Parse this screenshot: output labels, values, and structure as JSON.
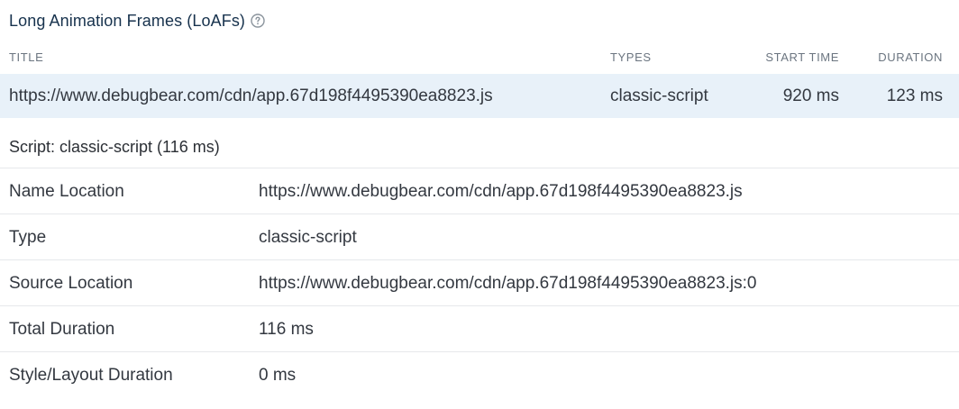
{
  "section": {
    "title": "Long Animation Frames (LoAFs)",
    "help_icon": "help-circle-icon"
  },
  "table": {
    "headers": {
      "title": "TITLE",
      "types": "TYPES",
      "start_time": "START TIME",
      "duration": "DURATION"
    },
    "rows": [
      {
        "title": "https://www.debugbear.com/cdn/app.67d198f4495390ea8823.js",
        "types": "classic-script",
        "start_time": "920 ms",
        "duration": "123 ms"
      }
    ]
  },
  "script": {
    "heading": "Script: classic-script (116 ms)",
    "details": [
      {
        "label": "Name Location",
        "value": "https://www.debugbear.com/cdn/app.67d198f4495390ea8823.js"
      },
      {
        "label": "Type",
        "value": "classic-script"
      },
      {
        "label": "Source Location",
        "value": "https://www.debugbear.com/cdn/app.67d198f4495390ea8823.js:0"
      },
      {
        "label": "Total Duration",
        "value": "116 ms"
      },
      {
        "label": "Style/Layout Duration",
        "value": "0 ms"
      }
    ]
  },
  "colors": {
    "title": "#17324d",
    "selected_row_bg": "#e8f1f9",
    "header_text": "#6b7580",
    "divider": "#e6e8eb"
  }
}
